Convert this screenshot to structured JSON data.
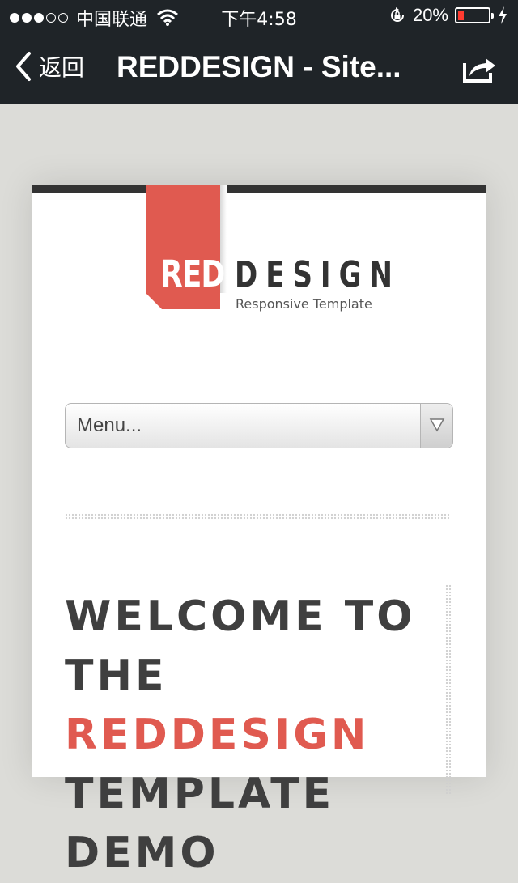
{
  "status_bar": {
    "carrier": "中国联通",
    "time": "下午4:58",
    "battery_percent": "20%",
    "battery_level": 0.2,
    "signal_bars_filled": 3,
    "signal_bars_total": 5
  },
  "nav_bar": {
    "back_label": "返回",
    "title": "REDDESIGN - Site..."
  },
  "page": {
    "logo": {
      "red_text": "RED",
      "design_text": "DESIGN",
      "tagline": "Responsive Template"
    },
    "menu": {
      "selected_value": "Menu..."
    },
    "welcome": {
      "line1": "WELCOME TO",
      "line2_prefix": "THE ",
      "line2_accent": "REDDESIGN",
      "line3": "TEMPLATE",
      "line4": "DEMO"
    }
  },
  "colors": {
    "accent": "#e05a50",
    "status_bar_bg": "#1f2428",
    "page_bg": "#dcdcd8",
    "heading_text": "#3f3f3f"
  },
  "icons": {
    "back": "chevron-left-icon",
    "share": "share-icon",
    "wifi": "wifi-icon",
    "rotation_lock": "rotation-lock-icon",
    "charging": "charging-bolt-icon",
    "dropdown": "triangle-down-icon"
  }
}
